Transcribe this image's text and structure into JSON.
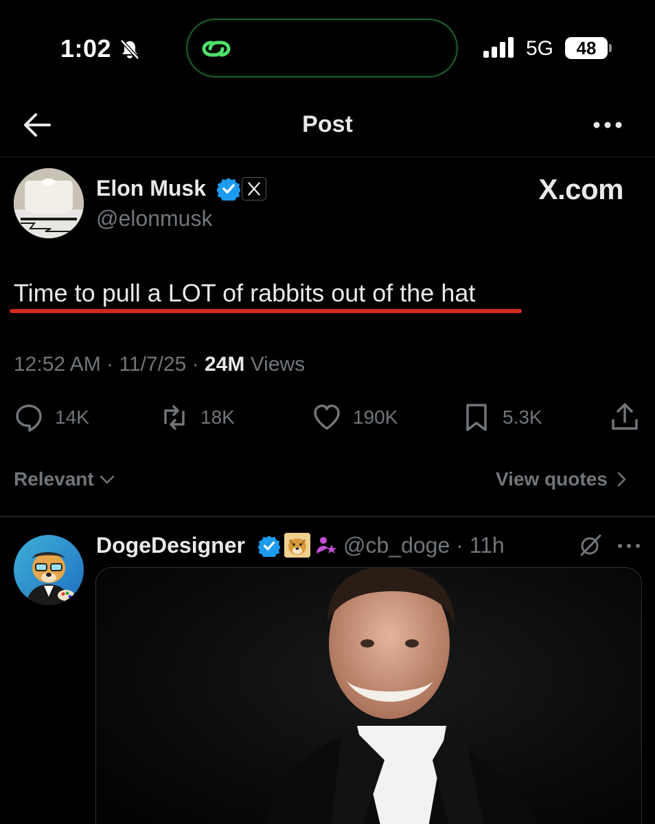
{
  "status_bar": {
    "time": "1:02",
    "network": "5G",
    "battery": "48",
    "icons": [
      "bell-slash-icon",
      "link-icon",
      "signal-icon"
    ]
  },
  "header": {
    "title": "Post",
    "icons": [
      "back-arrow-icon",
      "more-icon"
    ]
  },
  "post": {
    "author_name": "Elon Musk",
    "author_handle": "@elonmusk",
    "affiliation_label": "X.com",
    "text": "Time to pull a LOT of rabbits out of the hat",
    "time": "12:52 AM",
    "date": "11/7/25",
    "views_count": "24M",
    "views_label": "Views",
    "actions": {
      "replies": "14K",
      "reposts": "18K",
      "likes": "190K",
      "bookmarks": "5.3K"
    }
  },
  "replies_bar": {
    "sort_label": "Relevant",
    "quotes_label": "View quotes"
  },
  "reply": {
    "author_name": "DogeDesigner",
    "handle_time": "@cb_doge · 11h"
  },
  "colors": {
    "background": "#000000",
    "text_primary": "#e7e9ea",
    "text_secondary": "#71767b",
    "verified": "#1d9bf0",
    "highlight_underline": "#d02a1f",
    "island_border": "#1f5d2a"
  }
}
